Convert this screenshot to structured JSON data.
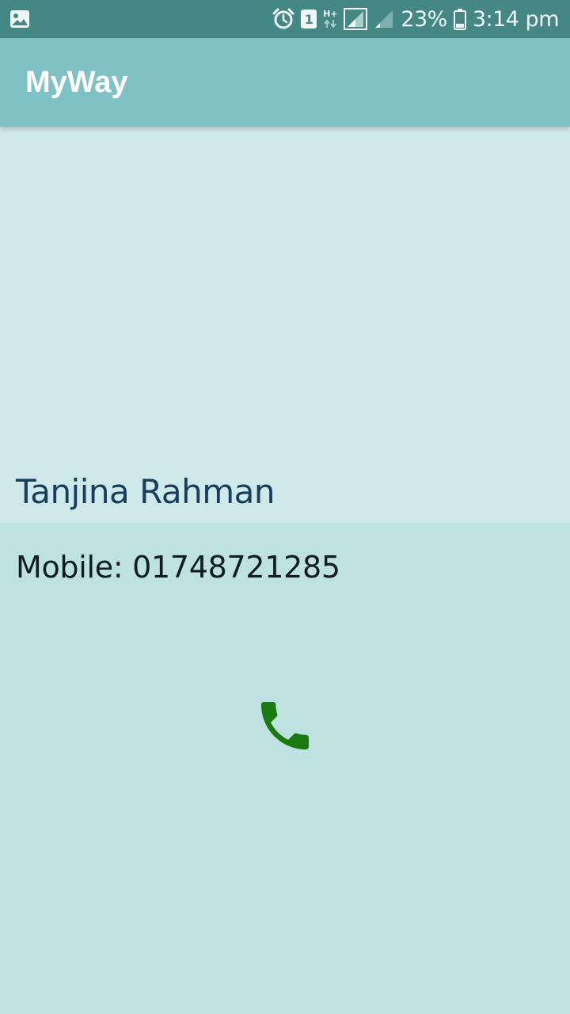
{
  "status_bar": {
    "battery_percent": "23%",
    "time": "3:14 pm",
    "sim_slot": "1",
    "network_type": "H+",
    "icons": [
      "image-notification-icon",
      "alarm-icon",
      "sim-icon",
      "data-arrows-icon",
      "signal-icon",
      "signal-weak-icon",
      "battery-icon"
    ]
  },
  "app_bar": {
    "title": "MyWay"
  },
  "contact": {
    "name": "Tanjina Rahman",
    "mobile_line": "Mobile: 01748721285",
    "call_icon": "phone-icon",
    "call_icon_color": "#1a7a10"
  },
  "colors": {
    "status_bar": "#458784",
    "app_bar": "#80c1c6",
    "header_bg": "#cfe8e9",
    "body_bg": "#bee2e2",
    "name_text": "#153f5d"
  }
}
